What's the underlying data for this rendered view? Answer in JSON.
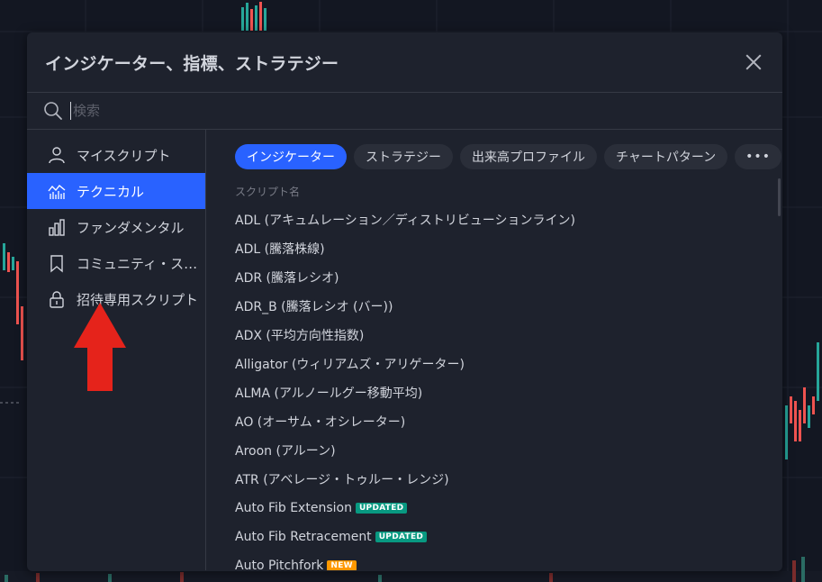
{
  "dialog": {
    "title": "インジケーター、指標、ストラテジー",
    "search_placeholder": "検索"
  },
  "sidebar": {
    "items": [
      {
        "label": "マイスクリプト",
        "icon": "user-icon",
        "active": false
      },
      {
        "label": "テクニカル",
        "icon": "technicals-chart-icon",
        "active": true
      },
      {
        "label": "ファンダメンタル",
        "icon": "bar-chart-icon",
        "active": false
      },
      {
        "label": "コミュニティ・スクリプト",
        "icon": "bookmark-icon",
        "active": false
      },
      {
        "label": "招待専用スクリプト",
        "icon": "lock-icon",
        "active": false
      }
    ]
  },
  "tabs": [
    {
      "label": "インジケーター",
      "active": true
    },
    {
      "label": "ストラテジー",
      "active": false
    },
    {
      "label": "出来高プロファイル",
      "active": false
    },
    {
      "label": "チャートパターン",
      "active": false
    },
    {
      "label": "•••",
      "active": false
    }
  ],
  "list": {
    "column_header": "スクリプト名",
    "items": [
      {
        "name": "ADL (アキュムレーション／ディストリビューションライン)"
      },
      {
        "name": "ADL (騰落株線)"
      },
      {
        "name": "ADR (騰落レシオ)"
      },
      {
        "name": "ADR_B (騰落レシオ (バー))"
      },
      {
        "name": "ADX (平均方向性指数)"
      },
      {
        "name": "Alligator (ウィリアムズ・アリゲーター)"
      },
      {
        "name": "ALMA (アルノールグー移動平均)"
      },
      {
        "name": "AO (オーサム・オシレーター)"
      },
      {
        "name": "Aroon (アルーン)"
      },
      {
        "name": "ATR (アベレージ・トゥルー・レンジ)"
      },
      {
        "name": "Auto Fib Extension",
        "badge": "UPDATED"
      },
      {
        "name": "Auto Fib Retracement",
        "badge": "UPDATED"
      },
      {
        "name": "Auto Pitchfork",
        "badge": "NEW"
      }
    ]
  },
  "colors": {
    "accent": "#2962ff",
    "badge_updated": "#089981",
    "badge_new": "#ff9800",
    "annotation_arrow": "#e5231b"
  }
}
